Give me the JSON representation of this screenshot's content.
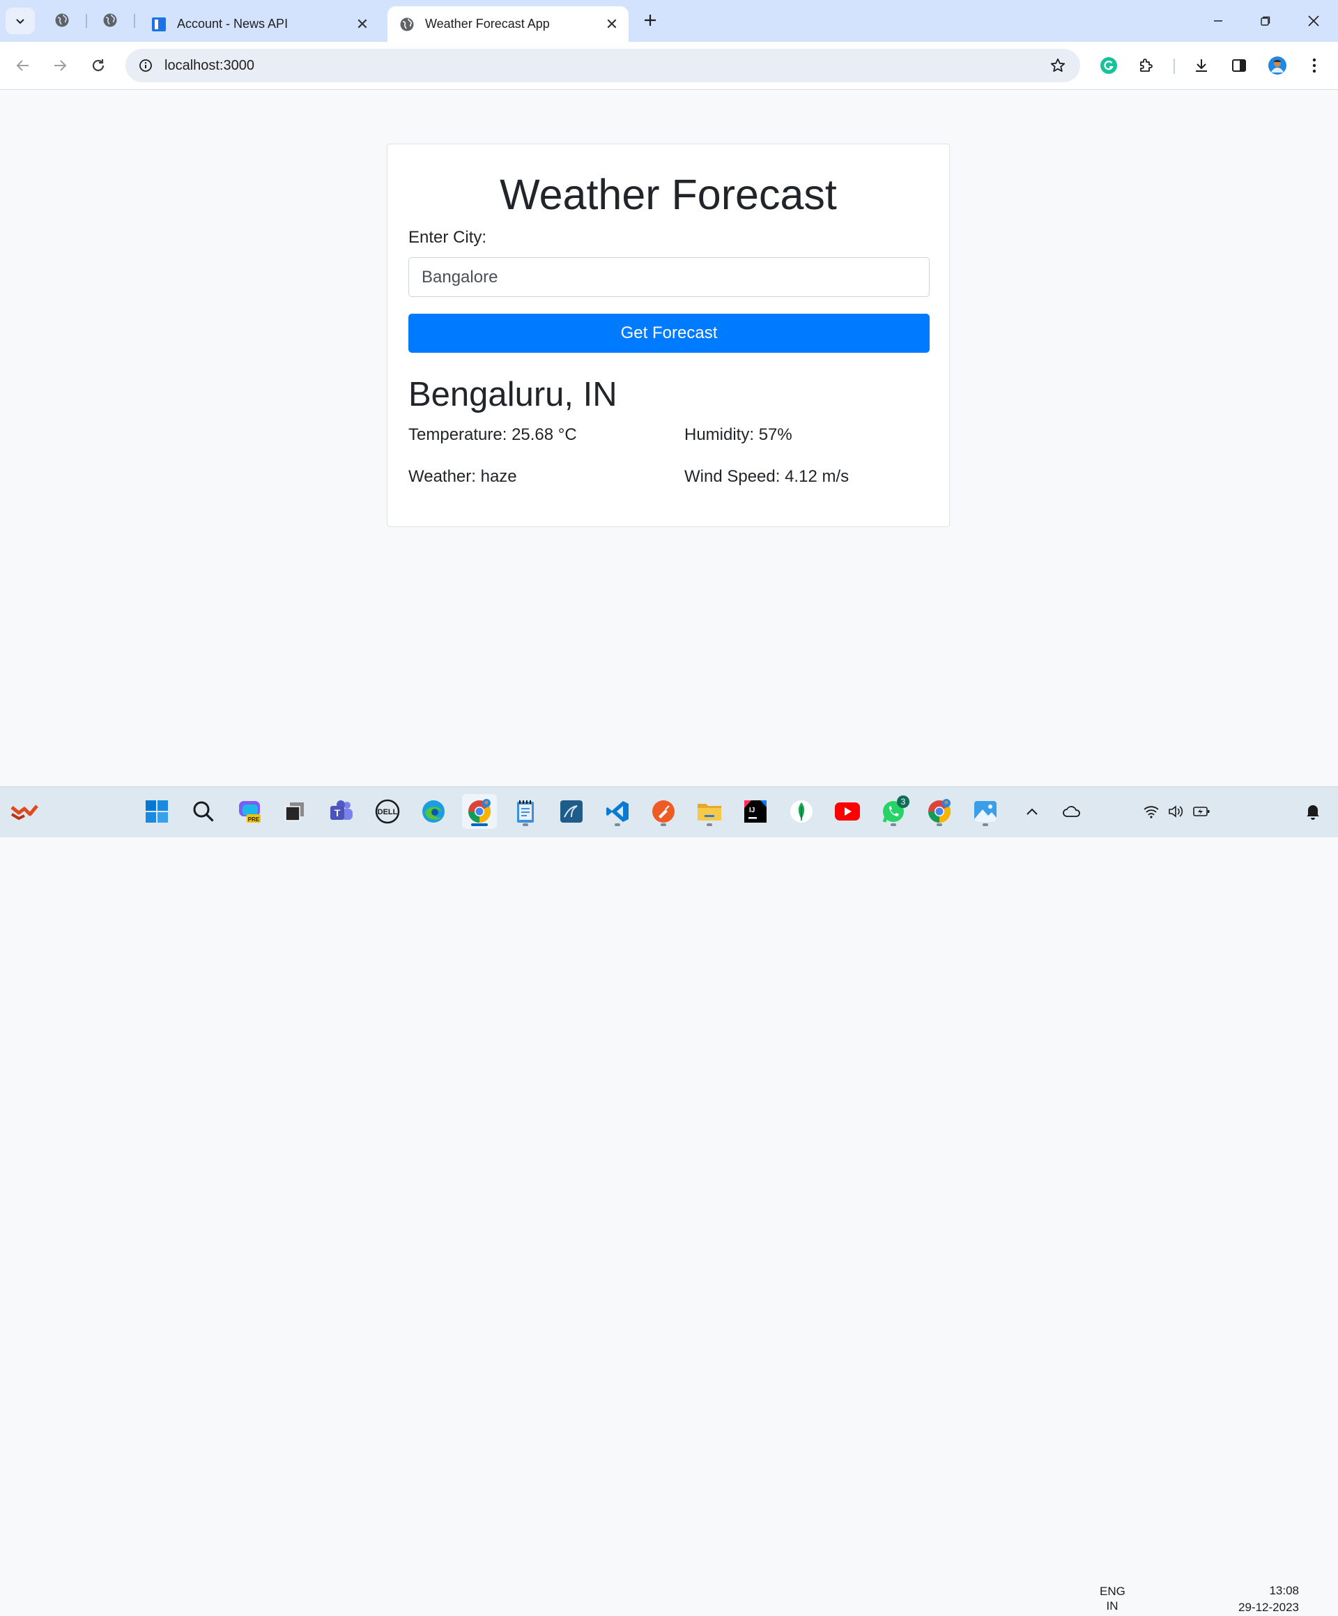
{
  "browser": {
    "tabs": [
      {
        "title": "Account - News API",
        "active": false
      },
      {
        "title": "Weather Forecast App",
        "active": true
      }
    ],
    "url": "localhost:3000"
  },
  "app": {
    "title": "Weather Forecast",
    "city_label": "Enter City:",
    "city_value": "Bangalore",
    "button_label": "Get Forecast",
    "result": {
      "location": "Bengaluru, IN",
      "temperature": "Temperature: 25.68 °C",
      "humidity": "Humidity: 57%",
      "weather": "Weather: haze",
      "wind": "Wind Speed: 4.12 m/s"
    },
    "colors": {
      "primary": "#007bff",
      "background": "#f8f9fa"
    }
  },
  "taskbar": {
    "apps": [
      "widgets",
      "start",
      "search",
      "copilot",
      "task-view",
      "teams",
      "dell",
      "edge",
      "chrome",
      "notepad",
      "mysql-workbench",
      "vscode",
      "postman",
      "file-explorer",
      "intellij",
      "mongodb-compass",
      "youtube",
      "whatsapp",
      "chrome-profile",
      "photos"
    ],
    "whatsapp_badge": "3",
    "language": "ENG",
    "region": "IN",
    "time": "13:08",
    "date": "29-12-2023"
  }
}
